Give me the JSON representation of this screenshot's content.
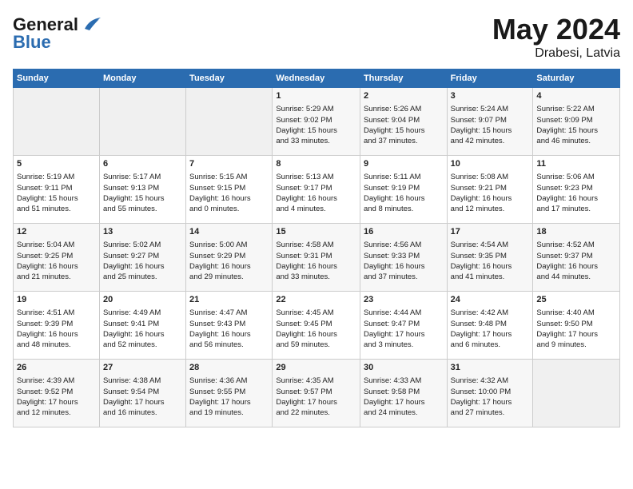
{
  "header": {
    "logo_line1": "General",
    "logo_line2": "Blue",
    "month_year": "May 2024",
    "location": "Drabesi, Latvia"
  },
  "days_of_week": [
    "Sunday",
    "Monday",
    "Tuesday",
    "Wednesday",
    "Thursday",
    "Friday",
    "Saturday"
  ],
  "weeks": [
    [
      {
        "day": "",
        "info": ""
      },
      {
        "day": "",
        "info": ""
      },
      {
        "day": "",
        "info": ""
      },
      {
        "day": "1",
        "info": "Sunrise: 5:29 AM\nSunset: 9:02 PM\nDaylight: 15 hours\nand 33 minutes."
      },
      {
        "day": "2",
        "info": "Sunrise: 5:26 AM\nSunset: 9:04 PM\nDaylight: 15 hours\nand 37 minutes."
      },
      {
        "day": "3",
        "info": "Sunrise: 5:24 AM\nSunset: 9:07 PM\nDaylight: 15 hours\nand 42 minutes."
      },
      {
        "day": "4",
        "info": "Sunrise: 5:22 AM\nSunset: 9:09 PM\nDaylight: 15 hours\nand 46 minutes."
      }
    ],
    [
      {
        "day": "5",
        "info": "Sunrise: 5:19 AM\nSunset: 9:11 PM\nDaylight: 15 hours\nand 51 minutes."
      },
      {
        "day": "6",
        "info": "Sunrise: 5:17 AM\nSunset: 9:13 PM\nDaylight: 15 hours\nand 55 minutes."
      },
      {
        "day": "7",
        "info": "Sunrise: 5:15 AM\nSunset: 9:15 PM\nDaylight: 16 hours\nand 0 minutes."
      },
      {
        "day": "8",
        "info": "Sunrise: 5:13 AM\nSunset: 9:17 PM\nDaylight: 16 hours\nand 4 minutes."
      },
      {
        "day": "9",
        "info": "Sunrise: 5:11 AM\nSunset: 9:19 PM\nDaylight: 16 hours\nand 8 minutes."
      },
      {
        "day": "10",
        "info": "Sunrise: 5:08 AM\nSunset: 9:21 PM\nDaylight: 16 hours\nand 12 minutes."
      },
      {
        "day": "11",
        "info": "Sunrise: 5:06 AM\nSunset: 9:23 PM\nDaylight: 16 hours\nand 17 minutes."
      }
    ],
    [
      {
        "day": "12",
        "info": "Sunrise: 5:04 AM\nSunset: 9:25 PM\nDaylight: 16 hours\nand 21 minutes."
      },
      {
        "day": "13",
        "info": "Sunrise: 5:02 AM\nSunset: 9:27 PM\nDaylight: 16 hours\nand 25 minutes."
      },
      {
        "day": "14",
        "info": "Sunrise: 5:00 AM\nSunset: 9:29 PM\nDaylight: 16 hours\nand 29 minutes."
      },
      {
        "day": "15",
        "info": "Sunrise: 4:58 AM\nSunset: 9:31 PM\nDaylight: 16 hours\nand 33 minutes."
      },
      {
        "day": "16",
        "info": "Sunrise: 4:56 AM\nSunset: 9:33 PM\nDaylight: 16 hours\nand 37 minutes."
      },
      {
        "day": "17",
        "info": "Sunrise: 4:54 AM\nSunset: 9:35 PM\nDaylight: 16 hours\nand 41 minutes."
      },
      {
        "day": "18",
        "info": "Sunrise: 4:52 AM\nSunset: 9:37 PM\nDaylight: 16 hours\nand 44 minutes."
      }
    ],
    [
      {
        "day": "19",
        "info": "Sunrise: 4:51 AM\nSunset: 9:39 PM\nDaylight: 16 hours\nand 48 minutes."
      },
      {
        "day": "20",
        "info": "Sunrise: 4:49 AM\nSunset: 9:41 PM\nDaylight: 16 hours\nand 52 minutes."
      },
      {
        "day": "21",
        "info": "Sunrise: 4:47 AM\nSunset: 9:43 PM\nDaylight: 16 hours\nand 56 minutes."
      },
      {
        "day": "22",
        "info": "Sunrise: 4:45 AM\nSunset: 9:45 PM\nDaylight: 16 hours\nand 59 minutes."
      },
      {
        "day": "23",
        "info": "Sunrise: 4:44 AM\nSunset: 9:47 PM\nDaylight: 17 hours\nand 3 minutes."
      },
      {
        "day": "24",
        "info": "Sunrise: 4:42 AM\nSunset: 9:48 PM\nDaylight: 17 hours\nand 6 minutes."
      },
      {
        "day": "25",
        "info": "Sunrise: 4:40 AM\nSunset: 9:50 PM\nDaylight: 17 hours\nand 9 minutes."
      }
    ],
    [
      {
        "day": "26",
        "info": "Sunrise: 4:39 AM\nSunset: 9:52 PM\nDaylight: 17 hours\nand 12 minutes."
      },
      {
        "day": "27",
        "info": "Sunrise: 4:38 AM\nSunset: 9:54 PM\nDaylight: 17 hours\nand 16 minutes."
      },
      {
        "day": "28",
        "info": "Sunrise: 4:36 AM\nSunset: 9:55 PM\nDaylight: 17 hours\nand 19 minutes."
      },
      {
        "day": "29",
        "info": "Sunrise: 4:35 AM\nSunset: 9:57 PM\nDaylight: 17 hours\nand 22 minutes."
      },
      {
        "day": "30",
        "info": "Sunrise: 4:33 AM\nSunset: 9:58 PM\nDaylight: 17 hours\nand 24 minutes."
      },
      {
        "day": "31",
        "info": "Sunrise: 4:32 AM\nSunset: 10:00 PM\nDaylight: 17 hours\nand 27 minutes."
      },
      {
        "day": "",
        "info": ""
      }
    ]
  ]
}
